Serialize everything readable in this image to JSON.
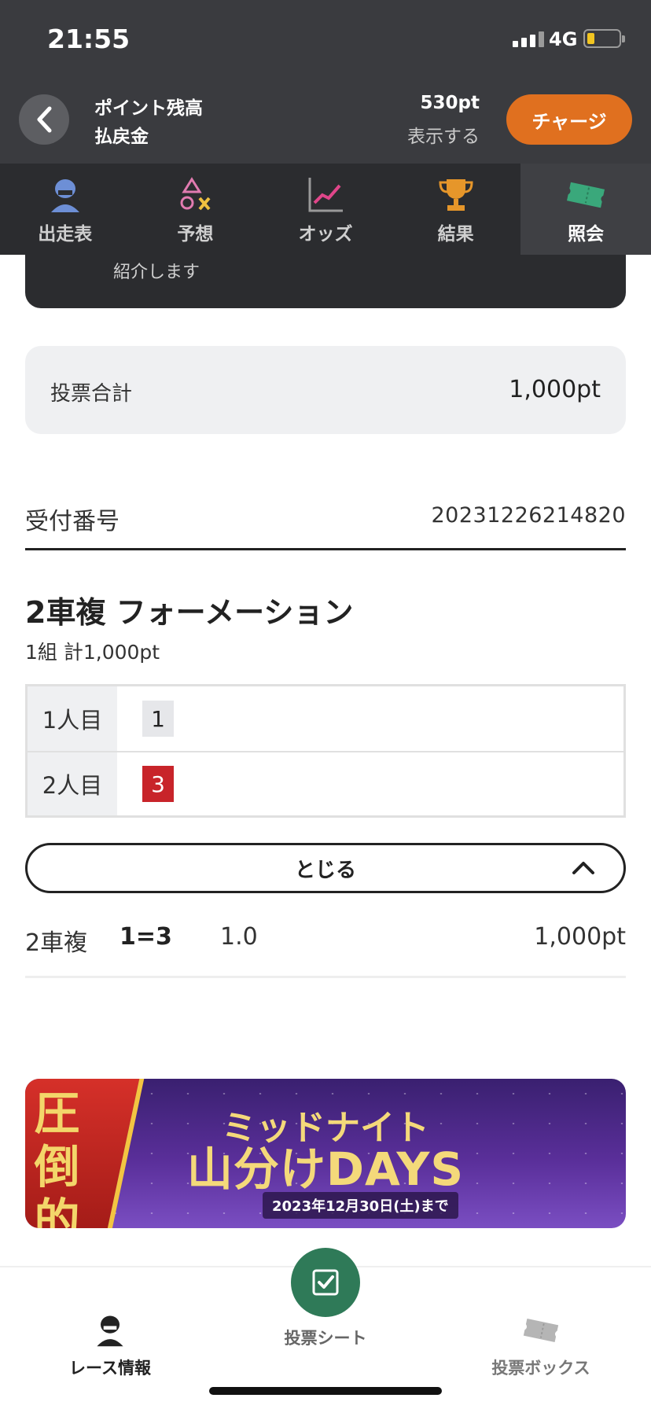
{
  "status_bar": {
    "time": "21:55",
    "network": "4G",
    "battery_level": 0.15
  },
  "header": {
    "points_label": "ポイント残高",
    "refund_label": "払戻金",
    "points_value": "530pt",
    "show_label": "表示する",
    "charge_label": "チャージ"
  },
  "tabs": [
    {
      "label": "出走表",
      "icon": "rider-icon"
    },
    {
      "label": "予想",
      "icon": "prediction-icon"
    },
    {
      "label": "オッズ",
      "icon": "odds-chart-icon"
    },
    {
      "label": "結果",
      "icon": "trophy-icon"
    },
    {
      "label": "照会",
      "icon": "ticket-icon",
      "active": true
    }
  ],
  "intro_text": "紹介します",
  "total": {
    "label": "投票合計",
    "value": "1,000pt"
  },
  "receipt": {
    "label": "受付番号",
    "value": "20231226214820"
  },
  "bet": {
    "title": "2車複 フォーメーション",
    "summary": "1組 計1,000pt",
    "rows": [
      {
        "label": "1人目",
        "number": "1"
      },
      {
        "label": "2人目",
        "number": "3"
      }
    ],
    "close_label": "とじる",
    "result": {
      "type": "2車複",
      "combo": "1=3",
      "odds": "1.0",
      "amount": "1,000pt"
    }
  },
  "banner": {
    "ribbon": "圧倒的",
    "line1": "ミッドナイト",
    "line2": "山分けDAYS",
    "until": "2023年12月30日(土)まで"
  },
  "bottom_nav": [
    {
      "label": "レース情報",
      "icon": "rider-icon"
    },
    {
      "label": "投票シート",
      "icon": "check-icon"
    },
    {
      "label": "投票ボックス",
      "icon": "ticket-icon"
    }
  ],
  "colors": {
    "header_bg": "#3a3b3f",
    "charge": "#e0701f",
    "chip_3": "#c8242a",
    "fab": "#2f7a58"
  }
}
